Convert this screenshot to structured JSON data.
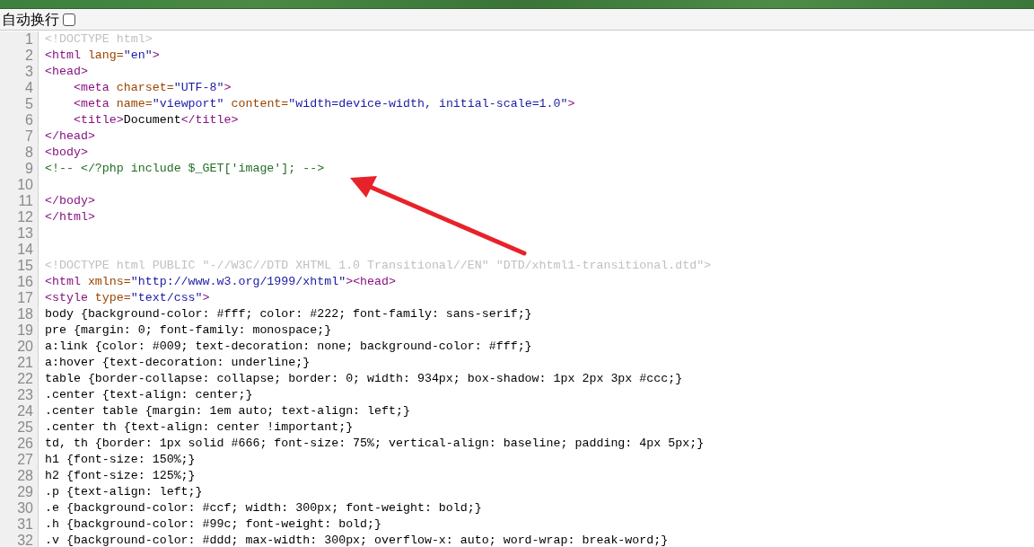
{
  "toolbar": {
    "wrap_label": "自动换行",
    "wrap_checked": false
  },
  "lines": [
    {
      "number": "1",
      "tokens": [
        {
          "kind": "doctype",
          "text": "<!DOCTYPE html>"
        }
      ]
    },
    {
      "number": "2",
      "tokens": [
        {
          "kind": "tag",
          "text": "<html"
        },
        {
          "kind": "attr",
          "text": " lang="
        },
        {
          "kind": "value",
          "text": "\"en\""
        },
        {
          "kind": "tag",
          "text": ">"
        }
      ]
    },
    {
      "number": "3",
      "tokens": [
        {
          "kind": "tag",
          "text": "<head>"
        }
      ]
    },
    {
      "number": "4",
      "tokens": [
        {
          "kind": "tag",
          "text": "    <meta"
        },
        {
          "kind": "attr",
          "text": " charset="
        },
        {
          "kind": "value",
          "text": "\"UTF-8\""
        },
        {
          "kind": "tag",
          "text": ">"
        }
      ]
    },
    {
      "number": "5",
      "tokens": [
        {
          "kind": "tag",
          "text": "    <meta"
        },
        {
          "kind": "attr",
          "text": " name="
        },
        {
          "kind": "value",
          "text": "\"viewport\""
        },
        {
          "kind": "attr",
          "text": " content="
        },
        {
          "kind": "value",
          "text": "\"width=device-width, initial-scale=1.0\""
        },
        {
          "kind": "tag",
          "text": ">"
        }
      ]
    },
    {
      "number": "6",
      "tokens": [
        {
          "kind": "tag",
          "text": "    <title>"
        },
        {
          "kind": "text",
          "text": "Document"
        },
        {
          "kind": "tag",
          "text": "</title>"
        }
      ]
    },
    {
      "number": "7",
      "tokens": [
        {
          "kind": "tag",
          "text": "</head>"
        }
      ]
    },
    {
      "number": "8",
      "tokens": [
        {
          "kind": "tag",
          "text": "<body>"
        }
      ]
    },
    {
      "number": "9",
      "tokens": [
        {
          "kind": "comment",
          "text": "<!-- </?php include $_GET['image']; -->"
        }
      ]
    },
    {
      "number": "10"
    },
    {
      "number": "11",
      "tokens": [
        {
          "kind": "tag",
          "text": "</body>"
        }
      ]
    },
    {
      "number": "12",
      "tokens": [
        {
          "kind": "tag",
          "text": "</html>"
        }
      ]
    },
    {
      "number": "13"
    },
    {
      "number": "14"
    },
    {
      "number": "15",
      "tokens": [
        {
          "kind": "doctype",
          "text": "<!DOCTYPE html PUBLIC \"-//W3C//DTD XHTML 1.0 Transitional//EN\" \"DTD/xhtml1-transitional.dtd\">"
        }
      ]
    },
    {
      "number": "16",
      "tokens": [
        {
          "kind": "tag",
          "text": "<html"
        },
        {
          "kind": "attr",
          "text": " xmlns="
        },
        {
          "kind": "value",
          "text": "\"http://www.w3.org/1999/xhtml\""
        },
        {
          "kind": "tag",
          "text": "><head>"
        }
      ]
    },
    {
      "number": "17",
      "tokens": [
        {
          "kind": "tag",
          "text": "<style"
        },
        {
          "kind": "attr",
          "text": " type="
        },
        {
          "kind": "value",
          "text": "\"text/css\""
        },
        {
          "kind": "tag",
          "text": ">"
        }
      ]
    },
    {
      "number": "18",
      "tokens": [
        {
          "kind": "text",
          "text": "body {background-color: #fff; color: #222; font-family: sans-serif;}"
        }
      ]
    },
    {
      "number": "19",
      "tokens": [
        {
          "kind": "text",
          "text": "pre {margin: 0; font-family: monospace;}"
        }
      ]
    },
    {
      "number": "20",
      "tokens": [
        {
          "kind": "text",
          "text": "a:link {color: #009; text-decoration: none; background-color: #fff;}"
        }
      ]
    },
    {
      "number": "21",
      "tokens": [
        {
          "kind": "text",
          "text": "a:hover {text-decoration: underline;}"
        }
      ]
    },
    {
      "number": "22",
      "tokens": [
        {
          "kind": "text",
          "text": "table {border-collapse: collapse; border: 0; width: 934px; box-shadow: 1px 2px 3px #ccc;}"
        }
      ]
    },
    {
      "number": "23",
      "tokens": [
        {
          "kind": "text",
          "text": ".center {text-align: center;}"
        }
      ]
    },
    {
      "number": "24",
      "tokens": [
        {
          "kind": "text",
          "text": ".center table {margin: 1em auto; text-align: left;}"
        }
      ]
    },
    {
      "number": "25",
      "tokens": [
        {
          "kind": "text",
          "text": ".center th {text-align: center !important;}"
        }
      ]
    },
    {
      "number": "26",
      "tokens": [
        {
          "kind": "text",
          "text": "td, th {border: 1px solid #666; font-size: 75%; vertical-align: baseline; padding: 4px 5px;}"
        }
      ]
    },
    {
      "number": "27",
      "tokens": [
        {
          "kind": "text",
          "text": "h1 {font-size: 150%;}"
        }
      ]
    },
    {
      "number": "28",
      "tokens": [
        {
          "kind": "text",
          "text": "h2 {font-size: 125%;}"
        }
      ]
    },
    {
      "number": "29",
      "tokens": [
        {
          "kind": "text",
          "text": ".p {text-align: left;}"
        }
      ]
    },
    {
      "number": "30",
      "tokens": [
        {
          "kind": "text",
          "text": ".e {background-color: #ccf; width: 300px; font-weight: bold;}"
        }
      ]
    },
    {
      "number": "31",
      "tokens": [
        {
          "kind": "text",
          "text": ".h {background-color: #99c; font-weight: bold;}"
        }
      ]
    },
    {
      "number": "32",
      "tokens": [
        {
          "kind": "text",
          "text": ".v {background-color: #ddd; max-width: 300px; overflow-x: auto; word-wrap: break-word;}"
        }
      ]
    }
  ]
}
